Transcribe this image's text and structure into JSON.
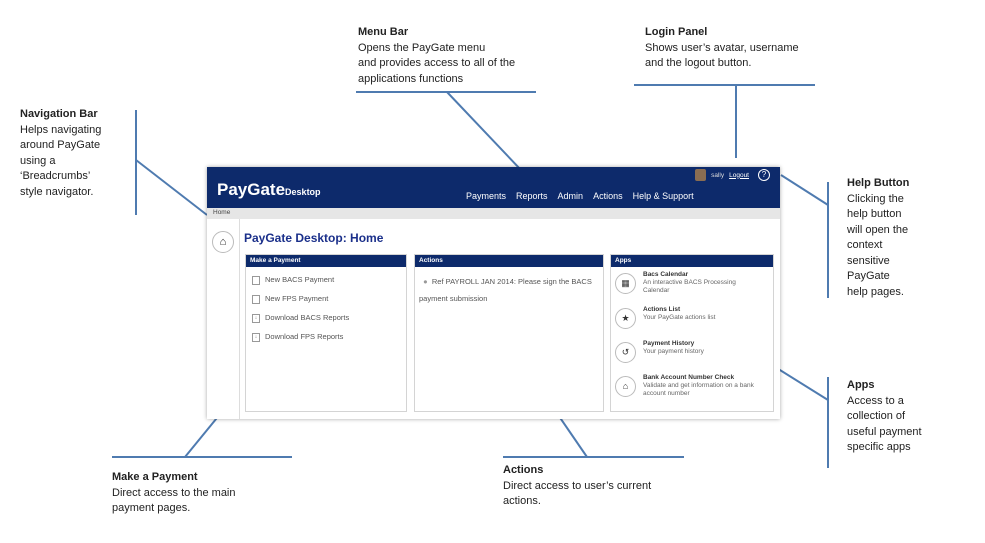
{
  "annotations": {
    "menu_bar": {
      "title": "Menu Bar",
      "desc": "Opens the PayGate menu\nand provides access to all of the\napplications functions"
    },
    "login_panel": {
      "title": "Login Panel",
      "desc": "Shows user’s avatar, username\nand the  logout button."
    },
    "navigation_bar": {
      "title": "Navigation  Bar",
      "desc": "Helps navigating\naround PayGate\nusing a\n‘Breadcrumbs’\nstyle navigator."
    },
    "help_button": {
      "title": "Help Button",
      "desc": "Clicking the\nhelp button\nwill open the\ncontext\nsensitive\nPayGate\nhelp pages."
    },
    "apps": {
      "title": "Apps",
      "desc": "Access to a\ncollection of\nuseful payment\nspecific apps"
    },
    "make_payment": {
      "title": "Make a Payment",
      "desc": "Direct access to the main\npayment pages."
    },
    "actions": {
      "title": "Actions",
      "desc": "Direct access to user’s current\nactions."
    }
  },
  "app": {
    "logo": "PayGate",
    "logo_suffix": "Desktop",
    "menu": [
      "Payments",
      "Reports",
      "Admin",
      "Actions",
      "Help & Support"
    ],
    "username": "sally",
    "logout": "Logout",
    "help": "?",
    "breadcrumb": "Home",
    "page_title": "PayGate Desktop: Home",
    "panels": {
      "payment": {
        "title": "Make a Payment",
        "items": [
          "New BACS Payment",
          "New FPS Payment",
          "Download BACS Reports",
          "Download FPS Reports"
        ]
      },
      "actions": {
        "title": "Actions",
        "item": "Ref PAYROLL JAN 2014: Please sign the BACS payment submission"
      },
      "apps": {
        "title": "Apps",
        "items": [
          {
            "name": "Bacs Calendar",
            "desc": "An interactive BACS Processing Calendar",
            "icon": "calendar-icon"
          },
          {
            "name": "Actions List",
            "desc": "Your PayGate actions list",
            "icon": "star-icon"
          },
          {
            "name": "Payment History",
            "desc": "Your payment history",
            "icon": "history-icon"
          },
          {
            "name": "Bank Account Number Check",
            "desc": "Validate and get information on a bank account number",
            "icon": "bank-icon"
          }
        ]
      }
    }
  }
}
